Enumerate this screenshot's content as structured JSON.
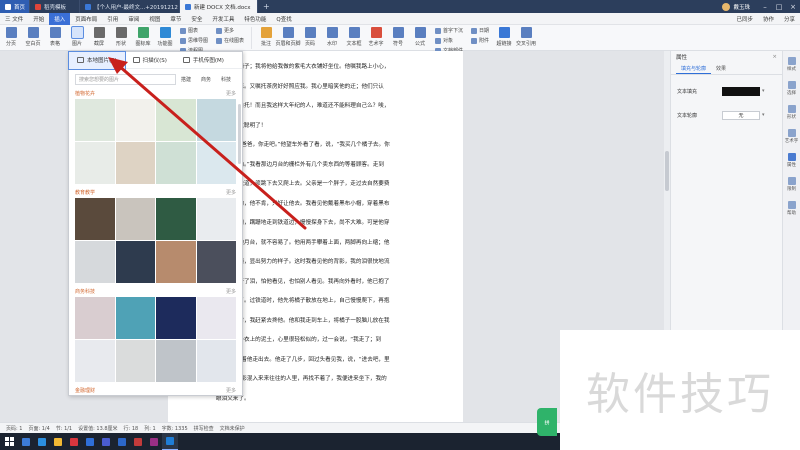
{
  "titlebar": {
    "tabs": [
      {
        "label": "首页",
        "color": "#2f5eb2"
      },
      {
        "label": "稻壳模板",
        "color": "#e0453a"
      },
      {
        "label": "【个人用户-最终文...+20191212",
        "color": "#3a78d6"
      },
      {
        "label": "新建 DOCX 文档.docx",
        "color": "#3a78d6"
      }
    ],
    "plus": "+",
    "user_name": "戴玉珠",
    "win_controls": [
      "–",
      "□",
      "×"
    ]
  },
  "menubar": {
    "items": [
      "三 文件",
      "开始",
      "插入",
      "页面布局",
      "引用",
      "审阅",
      "视图",
      "章节",
      "安全",
      "开发工具",
      "特色功能",
      "Q查找"
    ],
    "active_index": 2,
    "right_items": [
      "已同步",
      "协作",
      "分享"
    ]
  },
  "ribbon": {
    "buttons": [
      {
        "label": "分页",
        "color": "#5a7fc0"
      },
      {
        "label": "空白页",
        "color": "#5a7fc0"
      },
      {
        "label": "表格",
        "color": "#5a7fc0"
      },
      {
        "label": "图片",
        "color": "#5a7fc0"
      },
      {
        "label": "截屏",
        "color": "#6a6a6a"
      },
      {
        "label": "形状",
        "color": "#6a6a6a"
      },
      {
        "label": "图标库",
        "color": "#3fa46a"
      },
      {
        "label": "功能图",
        "color": "#2f8ad6"
      }
    ],
    "small_group_1": [
      "图表",
      "思维导图",
      "流程图"
    ],
    "small_group_2": [
      "更多",
      "在线图表"
    ],
    "buttons_2": [
      {
        "label": "批注",
        "color": "#e4a23a"
      },
      {
        "label": "页眉和页脚",
        "color": "#5a7fc0"
      },
      {
        "label": "页码",
        "color": "#5a7fc0"
      },
      {
        "label": "水印",
        "color": "#5a7fc0"
      },
      {
        "label": "文本框",
        "color": "#5a7fc0"
      },
      {
        "label": "艺术字",
        "color": "#d94e3c"
      },
      {
        "label": "符号",
        "color": "#5a7fc0"
      },
      {
        "label": "公式",
        "color": "#5a7fc0"
      }
    ],
    "small_group_3": [
      "首字下沉",
      "对象",
      "文档部件"
    ],
    "small_group_4": [
      "日期",
      "附件"
    ],
    "buttons_3": [
      {
        "label": "超链接",
        "color": "#3a78d6"
      },
      {
        "label": "交叉引用",
        "color": "#5a7fc0"
      }
    ]
  },
  "picture_panel": {
    "top_options": [
      "本地图片(P)",
      "扫描仪(S)",
      "手机传图(M)"
    ],
    "search_placeholder": "搜索您想要的图片",
    "search_categories": [
      "搭建",
      "商务",
      "科技"
    ],
    "sections": [
      {
        "title": "植物花卉",
        "more": "更多",
        "images": [
          "#dfe8de",
          "#f2f1ec",
          "#d8e6d4",
          "#c5d9e0",
          "#e8ece8",
          "#ded3c4",
          "#cfe0d5",
          "#dbe8ee"
        ]
      },
      {
        "title": "教育教学",
        "more": "更多",
        "images": [
          "#5a4a3c",
          "#c9c4bd",
          "#2f5b43",
          "#e9ecef",
          "#d6d9dc",
          "#2e3b4e",
          "#b78b6d",
          "#4b4f5c"
        ]
      },
      {
        "title": "商务科技",
        "more": "更多",
        "images": [
          "#d9cdd0",
          "#4fa2b6",
          "#1d2b5c",
          "#eae8ef",
          "#e8eaee",
          "#dadcdc",
          "#bfc4c9",
          "#e2e6ec"
        ]
      },
      {
        "title": "金融理财",
        "more": "更多",
        "images": []
      }
    ]
  },
  "document": {
    "lines": [
      "们的一张椅子；我将他给我做的紫毛大衣铺好坐位。他嘱我路上小心，",
      "，不要受凉。又嘱托茶房好好照应我。我心里暗笑他的迂；他们只认",
      "他们直是白托！而且我这样大年纪的人，难道还不能料理自己么？唉，",
      "想，真是太聪明了！",
      "我说道，“爸爸，你走吧。”他望车外看了看，说，“我买几个橘子去。你",
      "，不要走动。”我看那边月台的栅栏外有几个卖东西的等着顾客。走到",
      "，须穿过铁道，须跳下去又爬上去。父亲是一个胖子，走过去自然要费",
      "本来要去的，他不肯，只好让他去。我看见他戴着黑布小帽，穿着黑布",
      "深青布棉袍，蹒跚地走到铁道边，慢慢探身下去，尚不大难。可是他穿",
      "要爬上那边月台，就不容易了。他用两手攀着上面，两脚再向上缩；他",
      "子向左微倾，显出努力的样子。这时我看见他的背影，我的泪很快地流",
      "我赶紧拭干了泪，怕他看见，也怕别人看见。我再向外看时，他已抱了",
      "子望回走了。过铁道时，他先将橘子散放在地上，自己慢慢爬下，再抱",
      "。到这边时，我赶紧去搀他。他和我走到车上，将橘子一股脑儿放在我",
      "。于是扑扑衣上的泥土，心里很轻松似的，过一会说，“我走了；到",
      "信！”我望着他走出去。他走了几步，回过头看见我，说，“进去吧，里",
      "”等他的背影混入来来往往的人里，再找不着了，我便进来坐下，我的",
      "眼泪又来了。"
    ]
  },
  "right_panel": {
    "title": "属性",
    "close": "×",
    "tabs": [
      "填充与轮廓",
      "效果"
    ],
    "fill_label": "文本填充",
    "outline_label": "文本轮廓",
    "outline_value": "无",
    "fill_color": "#111111"
  },
  "right_strip": [
    "样式",
    "选择",
    "形状",
    "艺术字",
    "属性",
    "限制",
    "帮助"
  ],
  "statusbar": {
    "items": [
      "页码: 1",
      "页面: 1/4",
      "节: 1/1",
      "设置值: 13.8厘米",
      "行: 18",
      "列: 1",
      "字数: 1335",
      "拼写检查",
      "文档未保护"
    ]
  },
  "taskbar": {
    "icons": [
      "#3c7bd6",
      "#2b8fe0",
      "#f2b934",
      "#d9363e",
      "#2f6fd8",
      "#4a5cd1",
      "#2c67c9",
      "#c23b3b",
      "#9a2f85",
      "#1f7dd6"
    ]
  },
  "float_button": "拼",
  "watermark": "软件技巧"
}
